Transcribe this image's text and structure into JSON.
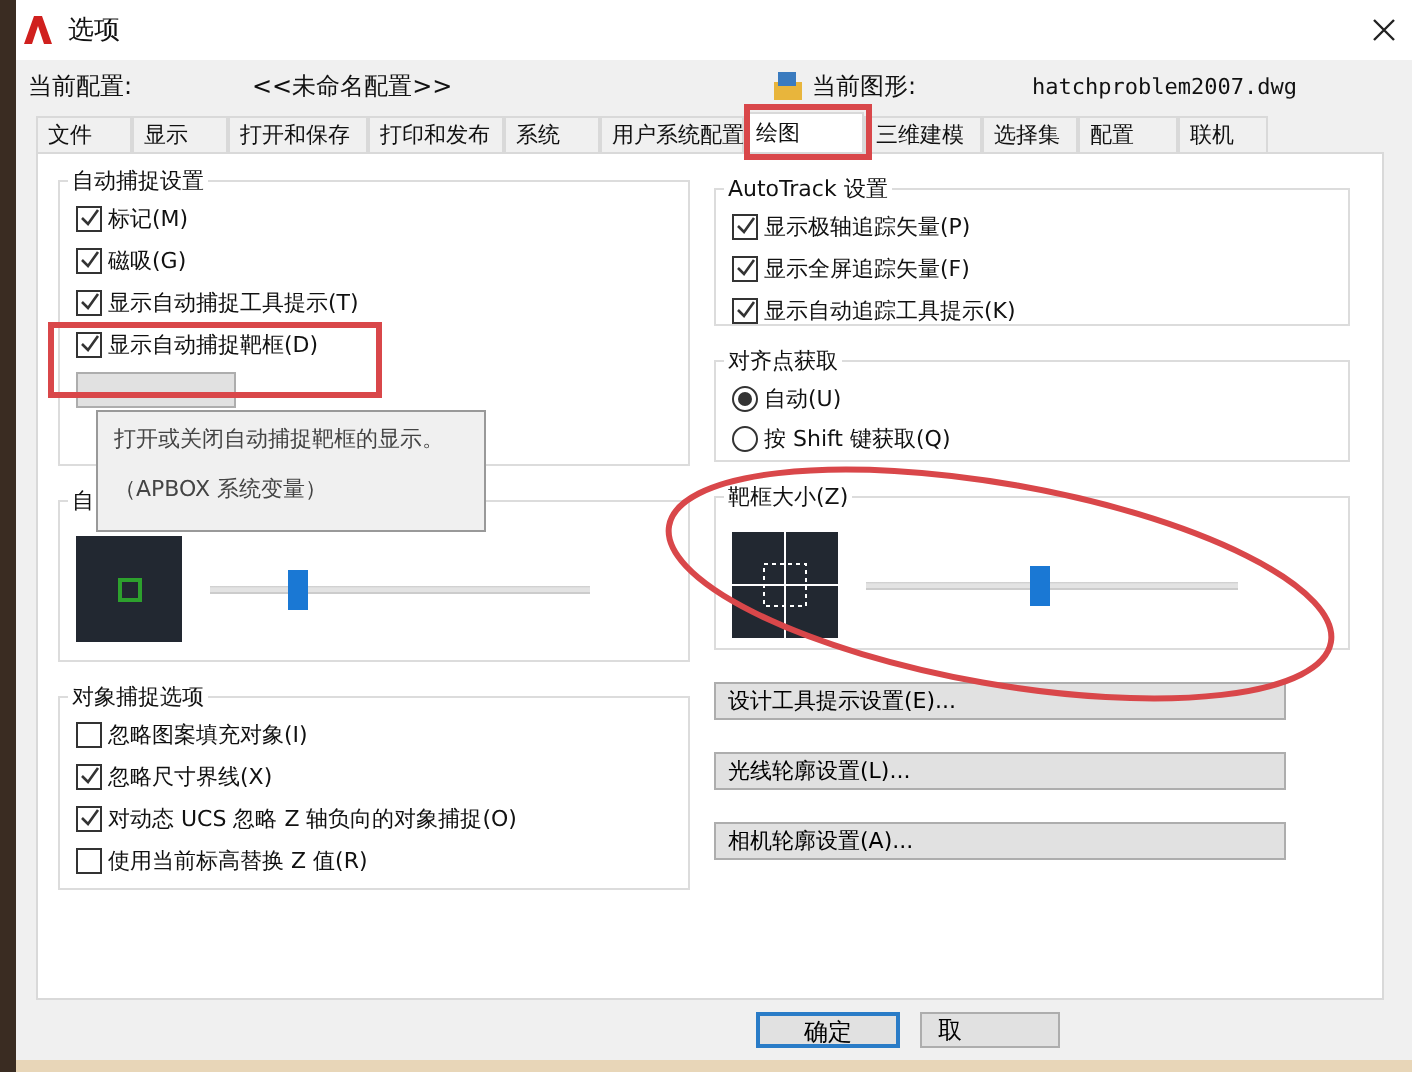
{
  "window": {
    "title": "选项"
  },
  "current_profile": {
    "label": "当前配置:",
    "value": "<<未命名配置>>"
  },
  "current_drawing": {
    "label": "当前图形:",
    "value": "hatchproblem2007.dwg"
  },
  "tabs": [
    {
      "label": "文件",
      "selected": false
    },
    {
      "label": "显示",
      "selected": false
    },
    {
      "label": "打开和保存",
      "selected": false
    },
    {
      "label": "打印和发布",
      "selected": false
    },
    {
      "label": "系统",
      "selected": false
    },
    {
      "label": "用户系统配置",
      "selected": false
    },
    {
      "label": "绘图",
      "selected": true
    },
    {
      "label": "三维建模",
      "selected": false
    },
    {
      "label": "选择集",
      "selected": false
    },
    {
      "label": "配置",
      "selected": false
    },
    {
      "label": "联机",
      "selected": false
    }
  ],
  "autosnap_settings": {
    "title": "自动捕捉设置",
    "options": [
      {
        "label": "标记(M)",
        "checked": true
      },
      {
        "label": "磁吸(G)",
        "checked": true
      },
      {
        "label": "显示自动捕捉工具提示(T)",
        "checked": true
      },
      {
        "label": "显示自动捕捉靶框(D)",
        "checked": true
      }
    ],
    "tooltip": [
      "打开或关闭自动捕捉靶框的显示。",
      "（APBOX 系统变量）"
    ]
  },
  "autosnap_marker_size": {
    "title": "自",
    "level": 0.23
  },
  "object_snap_options": {
    "title": "对象捕捉选项",
    "options": [
      {
        "label": "忽略图案填充对象(I)",
        "checked": false
      },
      {
        "label": "忽略尺寸界线(X)",
        "checked": true
      },
      {
        "label": "对动态 UCS 忽略 Z 轴负向的对象捕捉(O)",
        "checked": true
      },
      {
        "label": "使用当前标高替换 Z 值(R)",
        "checked": false
      }
    ]
  },
  "autotrack_settings": {
    "title": "AutoTrack 设置",
    "options": [
      {
        "label": "显示极轴追踪矢量(P)",
        "checked": true
      },
      {
        "label": "显示全屏追踪矢量(F)",
        "checked": true
      },
      {
        "label": "显示自动追踪工具提示(K)",
        "checked": true
      }
    ]
  },
  "alignment_point_acquisition": {
    "title": "对齐点获取",
    "options": [
      {
        "label": "自动(U)",
        "selected": true
      },
      {
        "label": "按 Shift 键获取(Q)",
        "selected": false
      }
    ]
  },
  "aperture_size": {
    "title": "靶框大小(Z)",
    "level": 0.47
  },
  "setting_buttons": [
    "设计工具提示设置(E)...",
    "光线轮廓设置(L)...",
    "相机轮廓设置(A)..."
  ],
  "footer_buttons": [
    {
      "label": "确定",
      "default": true
    },
    {
      "label": "取",
      "default": false
    }
  ]
}
